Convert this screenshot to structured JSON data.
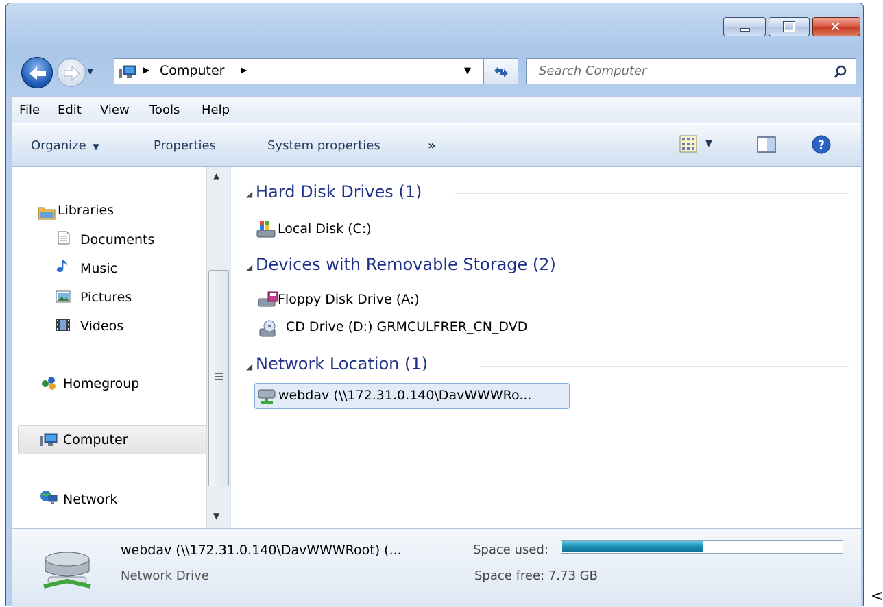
{
  "window": {
    "address": {
      "location": "Computer"
    },
    "search": {
      "placeholder": "Search Computer"
    }
  },
  "menu": [
    "File",
    "Edit",
    "View",
    "Tools",
    "Help"
  ],
  "toolbar": {
    "organize": "Organize",
    "properties": "Properties",
    "system_properties": "System properties",
    "more": "»"
  },
  "nav": {
    "libraries": "Libraries",
    "documents": "Documents",
    "music": "Music",
    "pictures": "Pictures",
    "videos": "Videos",
    "homegroup": "Homegroup",
    "computer": "Computer",
    "network": "Network"
  },
  "groups": {
    "hdd": {
      "title": "Hard Disk Drives (1)",
      "items": [
        "Local Disk (C:)"
      ]
    },
    "removable": {
      "title": "Devices with Removable Storage (2)",
      "items": [
        "Floppy Disk Drive (A:)",
        "CD Drive (D:) GRMCULFRER_CN_DVD"
      ]
    },
    "network": {
      "title": "Network Location (1)",
      "items": [
        "webdav (\\\\172.31.0.140\\DavWWWRo..."
      ]
    }
  },
  "details": {
    "name": "webdav (\\\\172.31.0.140\\DavWWWRoot) (...",
    "type": "Network Drive",
    "space_used_label": "Space used:",
    "space_used_fraction": 0.5,
    "space_free": "Space free: 7.73 GB"
  },
  "stray": "<",
  "colors": {
    "accent": "#1e3287",
    "selection": "#e2ecf9",
    "progress": "#1a8fb3"
  },
  "icons": [
    "back-arrow-icon",
    "forward-arrow-icon",
    "computer-icon",
    "refresh-icon",
    "search-icon",
    "views-icon",
    "preview-pane-icon",
    "help-icon",
    "library-icon",
    "document-icon",
    "music-icon",
    "pictures-icon",
    "videos-icon",
    "homegroup-icon",
    "network-icon",
    "local-disk-icon",
    "floppy-icon",
    "cd-drive-icon",
    "network-drive-icon"
  ]
}
